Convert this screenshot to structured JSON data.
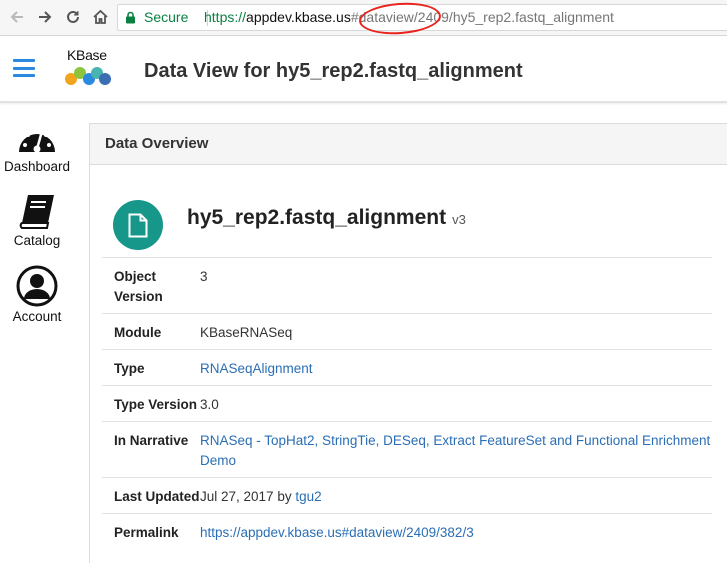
{
  "browser": {
    "secure_label": "Secure",
    "url_scheme": "https://",
    "url_host": "appdev.kbase.us",
    "url_rest": "#dataview/2409/hy5_rep2.fastq_alignment"
  },
  "header": {
    "logo_text": "KBase",
    "title": "Data View for hy5_rep2.fastq_alignment"
  },
  "sidebar": {
    "items": [
      {
        "label": "Dashboard",
        "icon": "dashboard-icon"
      },
      {
        "label": "Catalog",
        "icon": "catalog-book-icon"
      },
      {
        "label": "Account",
        "icon": "account-icon"
      }
    ]
  },
  "panel": {
    "title": "Data Overview",
    "object_name": "hy5_rep2.fastq_alignment",
    "object_version_badge": "v3",
    "rows": {
      "object_version": {
        "label": "Object Version",
        "value": "3"
      },
      "module": {
        "label": "Module",
        "value": "KBaseRNASeq"
      },
      "type": {
        "label": "Type",
        "value": "RNASeqAlignment"
      },
      "type_version": {
        "label": "Type Version",
        "value": "3.0"
      },
      "in_narrative": {
        "label": "In Narrative",
        "value": "RNASeq - TopHat2, StringTie, DESeq, Extract FeatureSet and Functional Enrichment Demo"
      },
      "last_updated": {
        "label": "Last Updated",
        "date": "Jul 27, 2017",
        "by": "by",
        "user": "tgu2"
      },
      "permalink": {
        "label": "Permalink",
        "value": "https://appdev.kbase.us#dataview/2409/382/3"
      }
    }
  },
  "colors": {
    "accent_blue": "#2a8ae0",
    "link": "#2a6eb5",
    "object_icon_bg": "#16978a",
    "secure_green": "#0b8043",
    "annotation_red": "#e8241c"
  }
}
